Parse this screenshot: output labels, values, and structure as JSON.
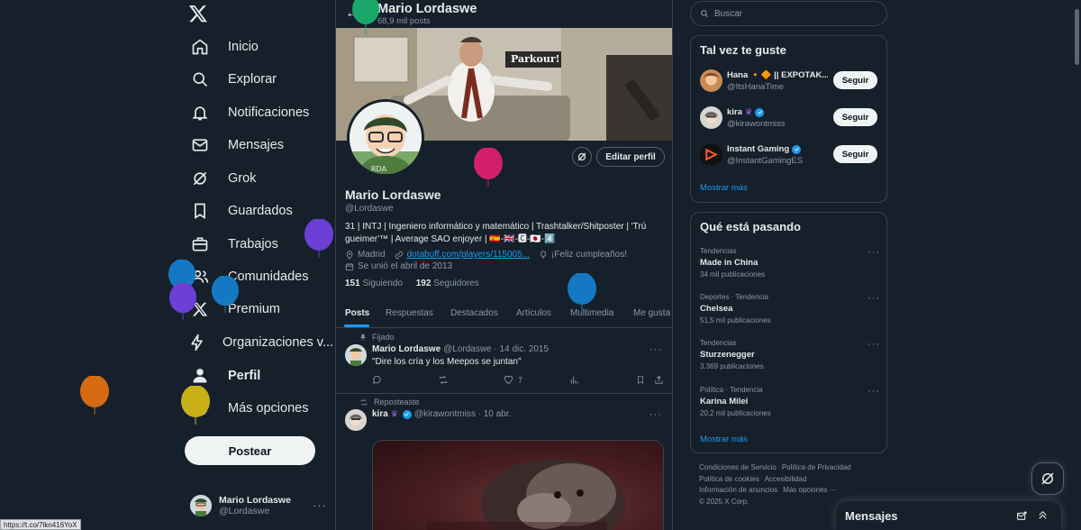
{
  "left_nav": {
    "items": [
      {
        "label": "Inicio",
        "icon": "home-icon"
      },
      {
        "label": "Explorar",
        "icon": "search-icon"
      },
      {
        "label": "Notificaciones",
        "icon": "bell-icon"
      },
      {
        "label": "Mensajes",
        "icon": "mail-icon"
      },
      {
        "label": "Grok",
        "icon": "grok-icon"
      },
      {
        "label": "Guardados",
        "icon": "bookmark-icon"
      },
      {
        "label": "Trabajos",
        "icon": "briefcase-icon"
      },
      {
        "label": "Comunidades",
        "icon": "people-icon"
      },
      {
        "label": "Premium",
        "icon": "x-logo-icon"
      },
      {
        "label": "Organizaciones v...",
        "icon": "lightning-icon"
      },
      {
        "label": "Perfil",
        "icon": "person-icon"
      },
      {
        "label": "Más opciones",
        "icon": "more-circle-icon"
      }
    ],
    "post_button": "Postear",
    "account": {
      "name": "Mario Lordaswe",
      "handle": "@Lordaswe"
    }
  },
  "header": {
    "name": "Mario Lordaswe",
    "post_count": "68,9 mil posts"
  },
  "profile": {
    "banner_caption": "Parkour!",
    "name": "Mario Lordaswe",
    "handle": "@Lordaswe",
    "edit_button": "Editar perfil",
    "bio_line1": "31 | INTJ | Ingeniero informático y matemático | Trashtalker/Shitposter | 'Trú",
    "bio_line2": "gueimer'™ | Average SAO enjoyer | 🇪🇸-🇬🇧-🅲-🇯🇵-4️⃣",
    "location": "Madrid",
    "link": "dotabuff.com/players/115005...",
    "birthday": "¡Feliz cumpleaños!",
    "joined": "Se unió el abril de 2013",
    "following_count": "151",
    "following_label": "Siguiendo",
    "followers_count": "192",
    "followers_label": "Seguidores"
  },
  "tabs": [
    "Posts",
    "Respuestas",
    "Destacados",
    "Artículos",
    "Multimedia",
    "Me gusta"
  ],
  "tweets": [
    {
      "context": "Fijado",
      "name": "Mario Lordaswe",
      "meta": "@Lordaswe · 14 dic. 2015",
      "text": "\"Dire los cría y los Meepos se juntan\"",
      "likes": "7"
    },
    {
      "context": "Reposteaste",
      "name": "kira",
      "meta": "@kirawontmiss · 10 abr."
    }
  ],
  "right": {
    "search_placeholder": "Buscar",
    "who_to_follow": {
      "title": "Tal vez te guste",
      "follow_label": "Seguir",
      "more": "Mostrar más",
      "accounts": [
        {
          "name": "Hana 🔸🔶 || EXPOTAK...",
          "handle": "@ItsHanaTime"
        },
        {
          "name": "kira",
          "handle": "@kirawontmiss"
        },
        {
          "name": "Instant Gaming",
          "handle": "@InstantGamingES"
        }
      ]
    },
    "trends": {
      "title": "Qué está pasando",
      "more": "Mostrar más",
      "items": [
        {
          "category": "Tendencias",
          "topic": "Made in China",
          "count": "34 mil publicaciones"
        },
        {
          "category": "Deportes · Tendencia",
          "topic": "Chelsea",
          "count": "51,5 mil publicaciones"
        },
        {
          "category": "Tendencias",
          "topic": "Sturzenegger",
          "count": "3.369 publicaciones"
        },
        {
          "category": "Política · Tendencia",
          "topic": "Karina Milei",
          "count": "20,2 mil publicaciones"
        }
      ]
    },
    "footer": [
      "Condiciones de Servicio",
      "Política de Privacidad",
      "Política de cookies",
      "Accesibilidad",
      "Información de anuncios",
      "Más opciones ···",
      "© 2025 X Corp."
    ]
  },
  "messages_drawer": {
    "title": "Mensajes"
  },
  "status_url": "https://t.co/7lkn416YoX",
  "colors": {
    "background": "#15202b",
    "accent": "#1d9bf0",
    "border": "#38444d"
  }
}
